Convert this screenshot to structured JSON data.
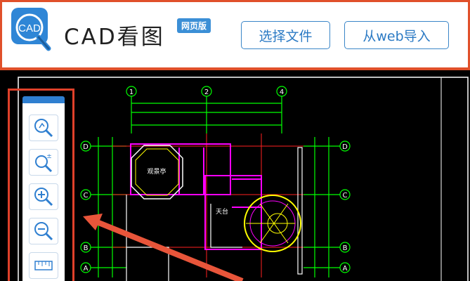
{
  "app": {
    "logo_text": "CAD",
    "title": "CAD看图",
    "badge": "网页版"
  },
  "header": {
    "select_file_label": "选择文件",
    "import_web_label": "从web导入"
  },
  "toolbar": {
    "tools": [
      {
        "name": "zoom-window-tool",
        "icon": "magnifier-window-icon"
      },
      {
        "name": "zoom-extents-tool",
        "icon": "magnifier-plus-minus-icon"
      },
      {
        "name": "zoom-in-tool",
        "icon": "zoom-in-icon"
      },
      {
        "name": "zoom-out-tool",
        "icon": "zoom-out-icon"
      },
      {
        "name": "measure-tool",
        "icon": "ruler-icon"
      }
    ]
  },
  "drawing": {
    "grid_top": [
      "1",
      "2",
      "4"
    ],
    "grid_left": [
      "D",
      "C",
      "B",
      "A"
    ],
    "grid_right": [
      "D",
      "C",
      "B",
      "A"
    ],
    "room_labels": [
      "观景亭",
      "天台"
    ]
  },
  "colors": {
    "accent": "#e0502a",
    "brand_blue": "#2f7fd0",
    "button_border": "#3a86c8",
    "cad_green": "#00ff00",
    "cad_magenta": "#ff00ff",
    "cad_yellow": "#ffff00",
    "cad_red": "#ff2020",
    "annotation_arrow": "#e8553a"
  }
}
